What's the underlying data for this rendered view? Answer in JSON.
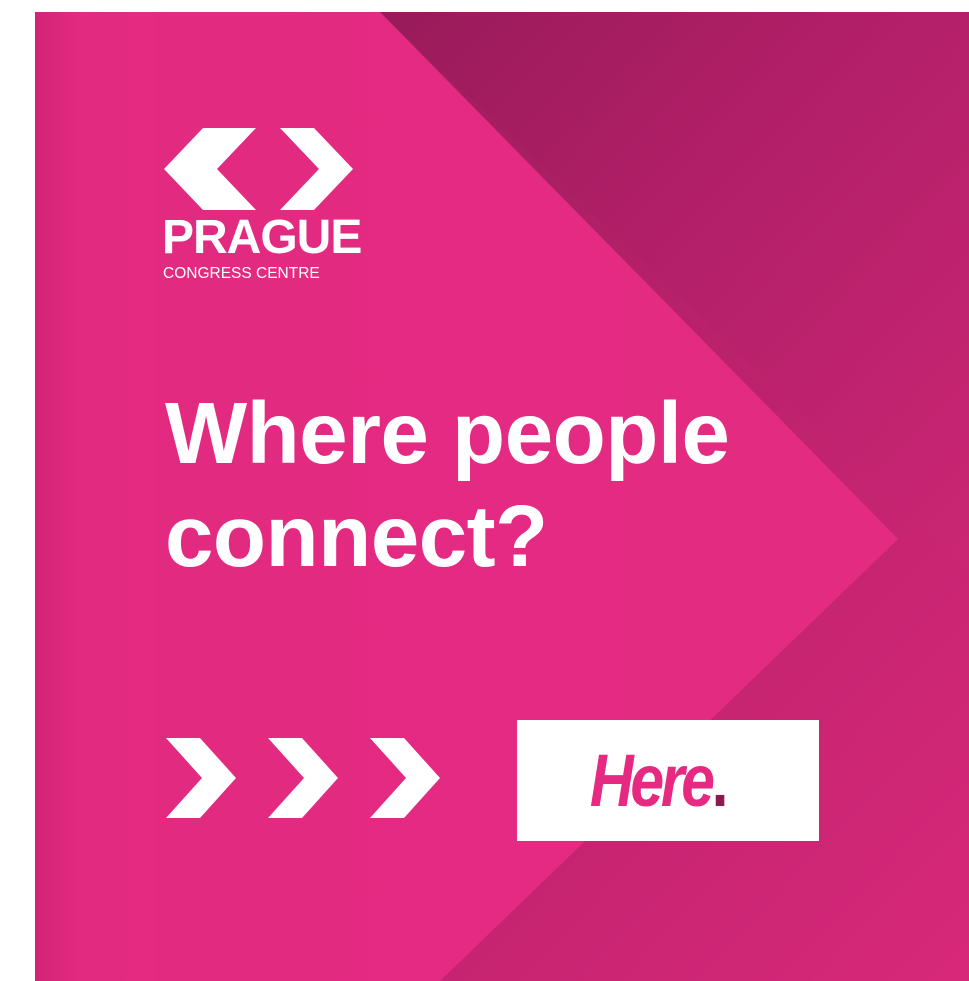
{
  "brand": {
    "name": "PRAGUE",
    "subtitle": "CONGRESS CENTRE",
    "logo_icon": "double-chevron-logo-icon"
  },
  "headline": {
    "line1": "Where people",
    "line2": "connect?"
  },
  "cta": {
    "arrows_icon": "triple-chevron-right-icon",
    "label": "Here",
    "punctuation": "."
  },
  "colors": {
    "primary_pink": "#e62a82",
    "dark_magenta": "#8c1a4f",
    "text": "#ffffff",
    "button_bg": "#ffffff"
  }
}
